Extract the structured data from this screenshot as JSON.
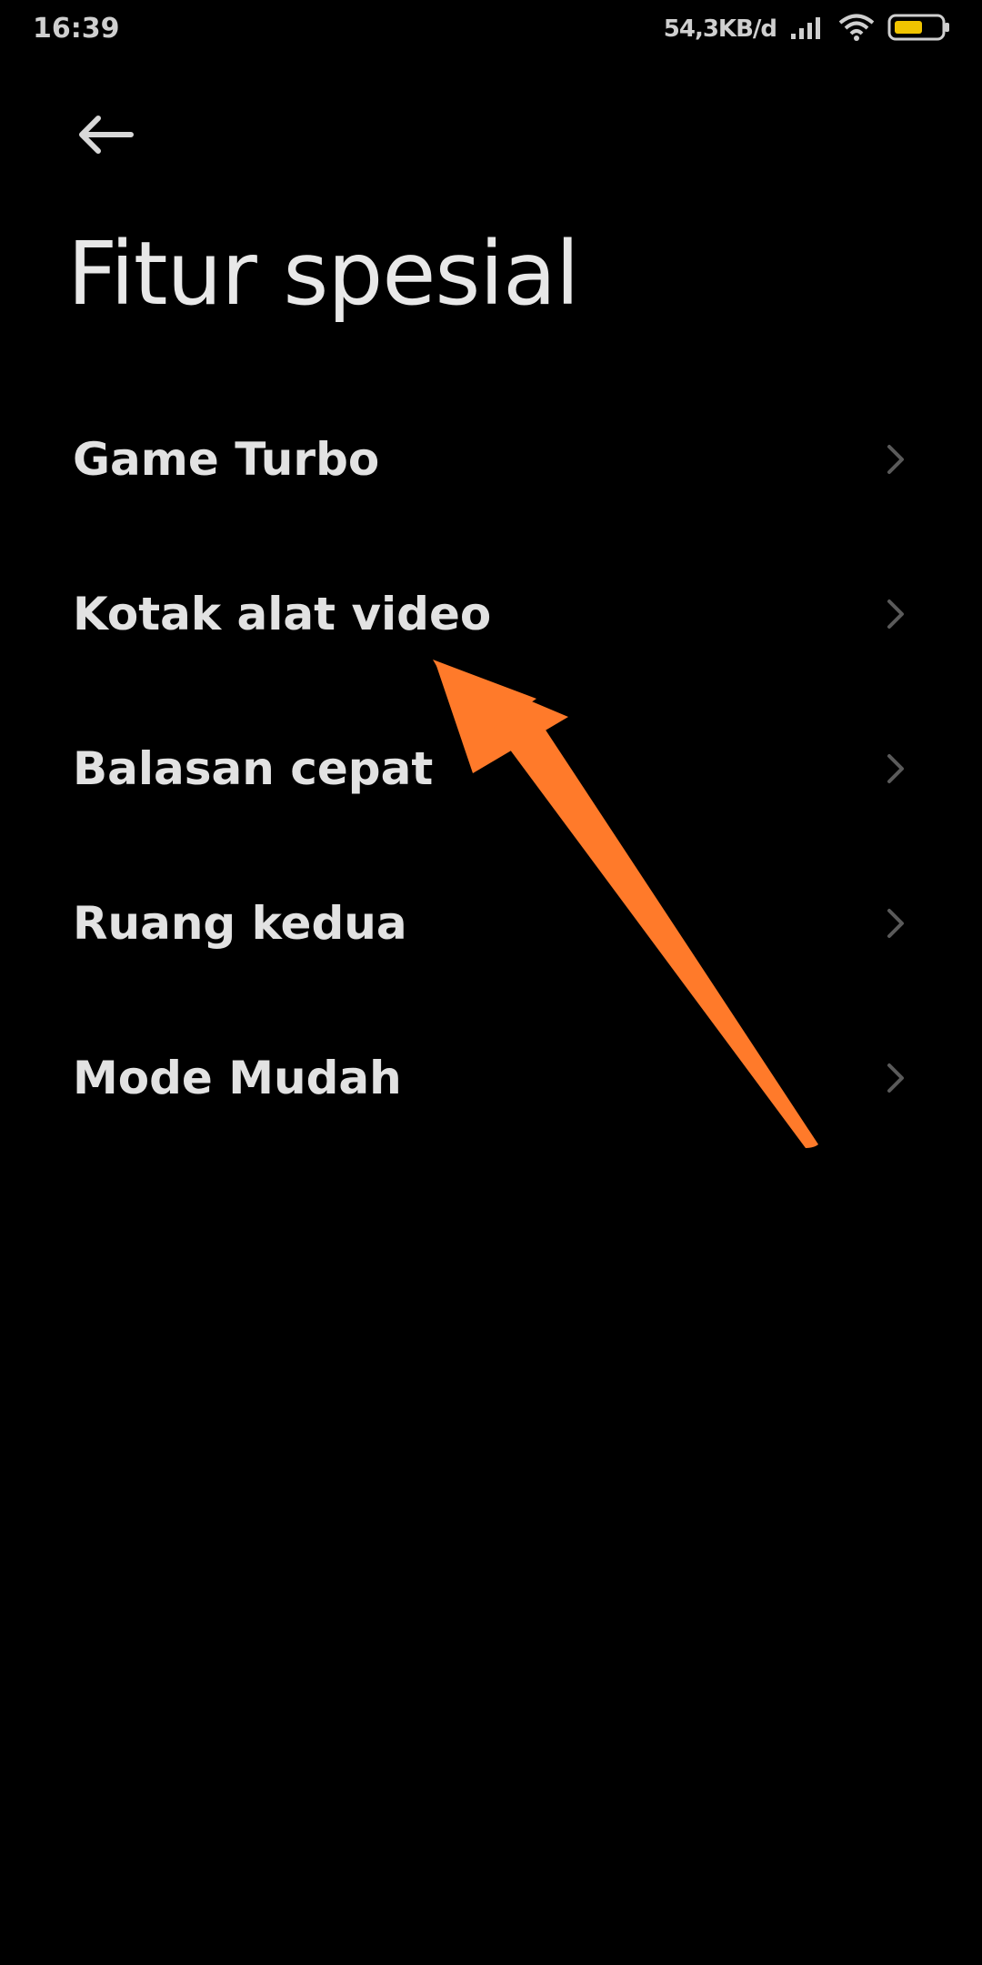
{
  "status_bar": {
    "time": "16:39",
    "network_speed": "54,3KB/d"
  },
  "header": {
    "title": "Fitur spesial"
  },
  "menu": {
    "items": [
      {
        "label": "Game Turbo"
      },
      {
        "label": "Kotak alat video"
      },
      {
        "label": "Balasan cepat"
      },
      {
        "label": "Ruang kedua"
      },
      {
        "label": "Mode Mudah"
      }
    ]
  },
  "icons": {
    "back": "arrow-left-icon",
    "chevron": "chevron-right-icon",
    "signal": "signal-icon",
    "wifi": "wifi-icon",
    "battery": "battery-icon",
    "annotation": "orange-arrow"
  },
  "colors": {
    "background": "#000000",
    "text": "#e2e2e2",
    "chevron": "#5a5a5a",
    "annotation_arrow": "#ff7a2a",
    "battery_fill": "#f0c400"
  }
}
